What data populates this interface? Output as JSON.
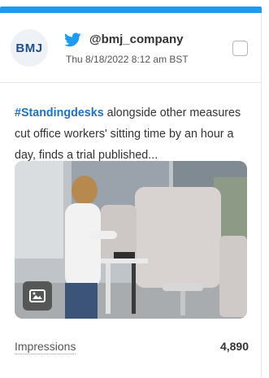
{
  "post": {
    "avatar_text": "BMJ",
    "platform_icon": "twitter-bird-icon",
    "handle": "@bmj_company",
    "timestamp": "Thu 8/18/2022 8:12 am BST",
    "hashtag": "#Standingdesks",
    "body_text": " alongside other measures cut office workers' sitting time by an hour a day, finds a trial published...",
    "media_icon": "image-icon",
    "brand_color": "#1d9bf0",
    "hashtag_color": "#1a73c8"
  },
  "stats": {
    "label": "Impressions",
    "value": "4,890"
  }
}
